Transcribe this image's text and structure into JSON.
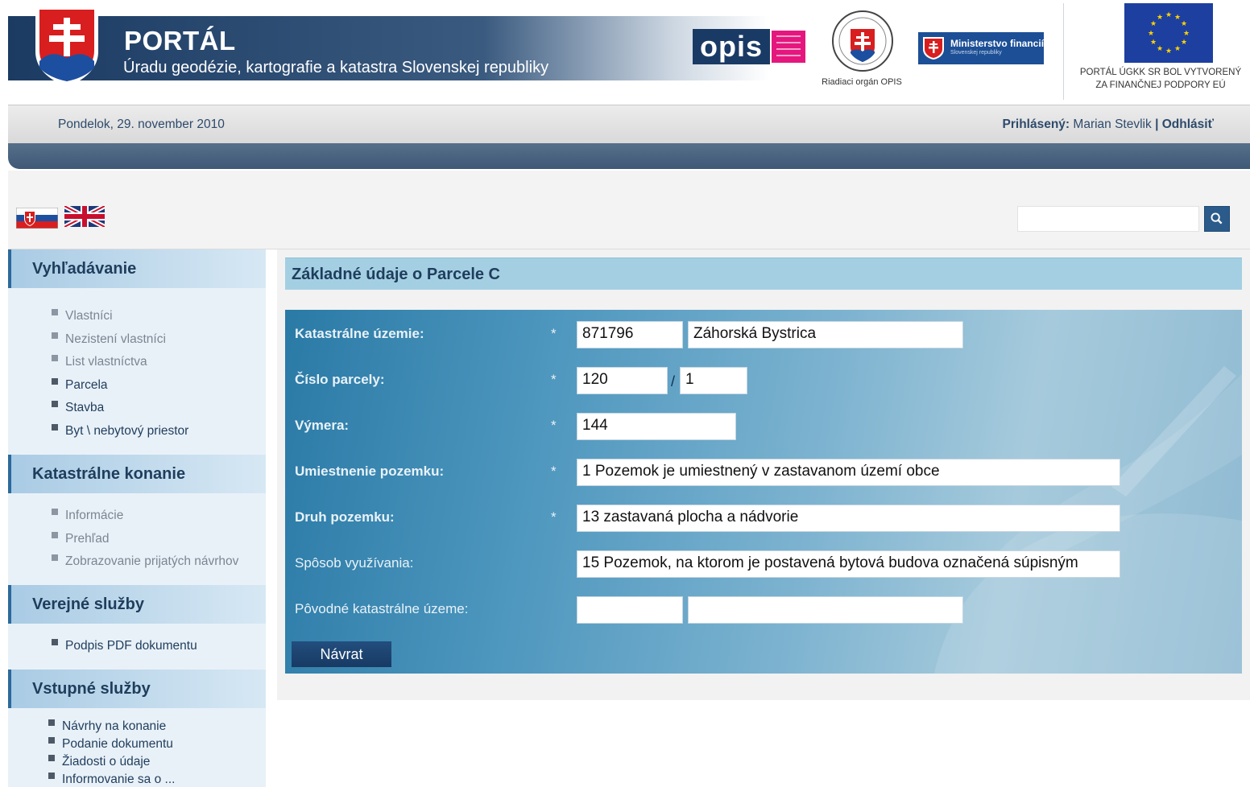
{
  "header": {
    "title": "PORTÁL",
    "subtitle": "Úradu geodézie, kartografie a katastra Slovenskej republiky",
    "opis_logo_text": "opis",
    "riadiaci_label": "Riadiaci orgán OPIS",
    "minfin_label": "Ministerstvo financií",
    "minfin_sub": "Slovenskej republiky",
    "eu_note_line1": "PORTÁL ÚGKK SR BOL VYTVORENÝ",
    "eu_note_line2": "ZA FINANČNEJ PODPORY EÚ"
  },
  "datebar": {
    "date": "Pondelok, 29. november 2010",
    "logged_label": "Prihlásený:",
    "user": "Marian Stevlik",
    "separator": "|",
    "logout": "Odhlásiť"
  },
  "search": {
    "value": "",
    "icon": "search-icon"
  },
  "languages": [
    {
      "code": "sk",
      "icon": "flag-slovakia-icon"
    },
    {
      "code": "en",
      "icon": "flag-uk-icon"
    }
  ],
  "sidebar": {
    "sections": [
      {
        "title": "Vyhľadávanie",
        "items": [
          "Vlastníci",
          "Nezistení vlastníci",
          "List vlastníctva",
          "Parcela",
          "Stavba",
          "Byt \\ nebytový priestor"
        ]
      },
      {
        "title": "Katastrálne konanie",
        "items": [
          "Informácie",
          "Prehľad",
          "Zobrazovanie prijatých návrhov"
        ]
      },
      {
        "title": "Verejné služby",
        "items": [
          "Podpis PDF dokumentu"
        ]
      },
      {
        "title": "Vstupné služby",
        "items": [
          "Návrhy na konanie",
          "Podanie dokumentu",
          "Žiadosti o údaje",
          "Informovanie sa o ..."
        ]
      }
    ]
  },
  "main": {
    "title": "Základné údaje o Parcele C",
    "required_mark": "*",
    "fields": {
      "katastralne_uzemie": {
        "label": "Katastrálne územie:",
        "code": "871796",
        "name": "Záhorská Bystrica"
      },
      "cislo_parcely": {
        "label": "Číslo parcely:",
        "main": "120",
        "slash": "/",
        "sub": "1"
      },
      "vymera": {
        "label": "Výmera:",
        "value": "144"
      },
      "umiestnenie": {
        "label": "Umiestnenie pozemku:",
        "value": "1 Pozemok je umiestnený v zastavanom území obce"
      },
      "druh": {
        "label": "Druh pozemku:",
        "value": "13 zastavaná plocha a nádvorie"
      },
      "sposob": {
        "label": "Spôsob využívania:",
        "value": "15 Pozemok, na ktorom je postavená bytová budova označená súpisným"
      },
      "povodne": {
        "label": "Pôvodné katastrálne územe:",
        "code": "",
        "name": ""
      }
    },
    "back_button": "Návrat"
  },
  "colors": {
    "banner_dark": "#1c3b63",
    "accent": "#2b5b8a",
    "sidebar_head": "#a9cbe4",
    "form_panel": "#4b95bd"
  }
}
